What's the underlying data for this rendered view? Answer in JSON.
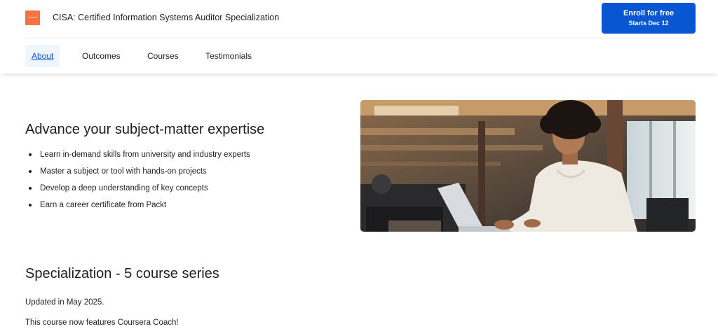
{
  "header": {
    "title": "CISA: Certified Information Systems Auditor Specialization",
    "enroll_label": "Enroll for free",
    "enroll_sublabel": "Starts Dec 12",
    "brand_color": "#0956d2",
    "logo_color": "#f4733f",
    "logo_icon": "packt-logo"
  },
  "tabs": [
    {
      "label": "About",
      "active": true
    },
    {
      "label": "Outcomes",
      "active": false
    },
    {
      "label": "Courses",
      "active": false
    },
    {
      "label": "Testimonials",
      "active": false
    }
  ],
  "about": {
    "heading": "Advance your subject-matter expertise",
    "bullets": [
      "Learn in-demand skills from university and industry experts",
      "Master a subject or tool with hands-on projects",
      "Develop a deep understanding of key concepts",
      "Earn a career certificate from Packt"
    ],
    "image": "person-working-on-laptop-photo"
  },
  "specialization": {
    "heading": "Specialization - 5 course series",
    "updated": "Updated in May 2025.",
    "coach_note": "This course now features Coursera Coach!"
  }
}
